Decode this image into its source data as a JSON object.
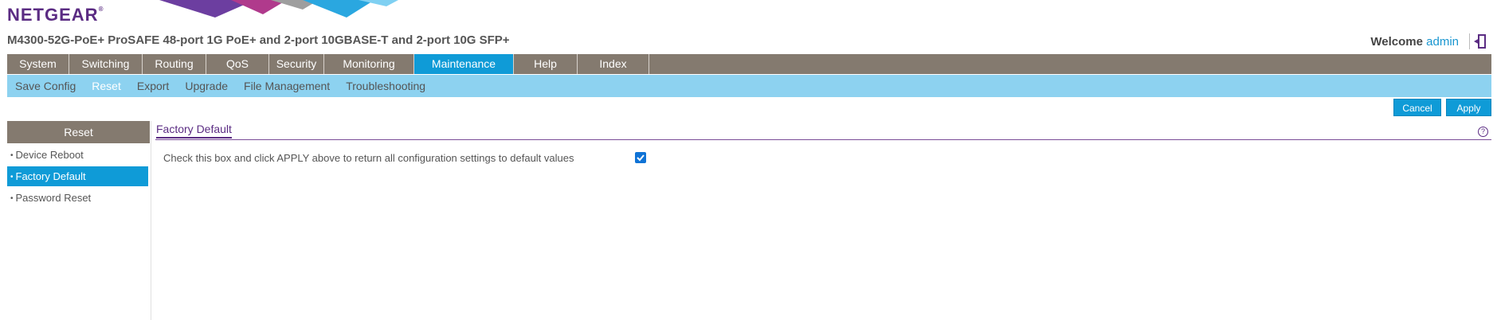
{
  "header": {
    "brand": "NETGEAR",
    "brand_mark": "®",
    "model_title": "M4300-52G-PoE+ ProSAFE 48-port 1G PoE+ and 2-port 10GBASE-T and 2-port 10G SFP+",
    "welcome_label": "Welcome",
    "username": "admin",
    "logout_icon": "logout-icon"
  },
  "main_nav": [
    {
      "label": "System"
    },
    {
      "label": "Switching"
    },
    {
      "label": "Routing"
    },
    {
      "label": "QoS"
    },
    {
      "label": "Security"
    },
    {
      "label": "Monitoring"
    },
    {
      "label": "Maintenance",
      "active": true
    },
    {
      "label": "Help"
    },
    {
      "label": "Index"
    }
  ],
  "sub_nav": [
    {
      "label": "Save Config"
    },
    {
      "label": "Reset",
      "active": true
    },
    {
      "label": "Export"
    },
    {
      "label": "Upgrade"
    },
    {
      "label": "File Management"
    },
    {
      "label": "Troubleshooting"
    }
  ],
  "actions": {
    "cancel": "Cancel",
    "apply": "Apply"
  },
  "sidebar": {
    "title": "Reset",
    "items": [
      {
        "label": "Device Reboot"
      },
      {
        "label": "Factory Default",
        "active": true
      },
      {
        "label": "Password Reset"
      }
    ]
  },
  "content": {
    "section_title": "Factory Default",
    "help_icon": "help-icon",
    "factory_default_label": "Check this box and click APPLY above to return all configuration settings to default values",
    "factory_default_checked": true
  },
  "colors": {
    "brand_purple": "#5b2c83",
    "nav_gray": "#847a6f",
    "active_blue": "#0f9bd7",
    "subnav_blue": "#8dd2f0"
  }
}
